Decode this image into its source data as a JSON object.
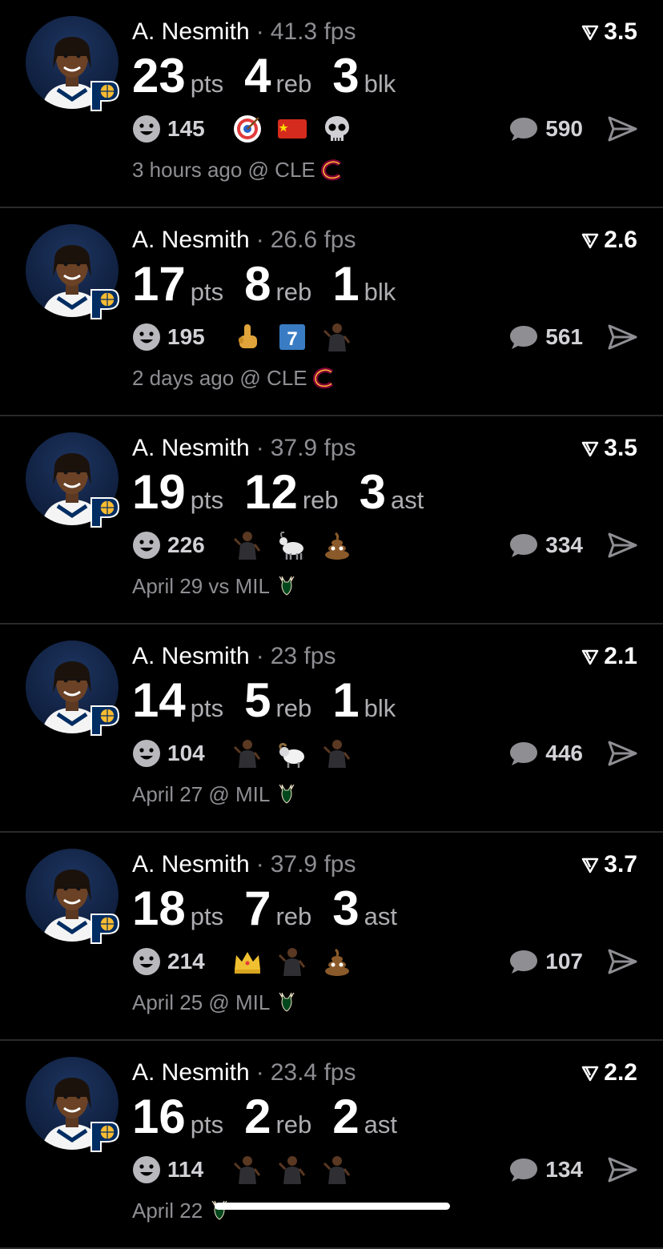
{
  "feed": {
    "posts": [
      {
        "player": "A. Nesmith",
        "fps": "41.3 fps",
        "rating": "3.5",
        "stats": [
          {
            "num": "23",
            "unit": "pts"
          },
          {
            "num": "4",
            "unit": "reb"
          },
          {
            "num": "3",
            "unit": "blk"
          }
        ],
        "reactions": "145",
        "emojis": [
          "target-icon",
          "china-flag-icon",
          "skull-icon"
        ],
        "comments": "590",
        "time": "3 hours ago @ CLE",
        "opponent_logo": "cavaliers-logo"
      },
      {
        "player": "A. Nesmith",
        "fps": "26.6 fps",
        "rating": "2.6",
        "stats": [
          {
            "num": "17",
            "unit": "pts"
          },
          {
            "num": "8",
            "unit": "reb"
          },
          {
            "num": "1",
            "unit": "blk"
          }
        ],
        "reactions": "195",
        "emojis": [
          "middle-finger-icon",
          "jersey-7-icon",
          "player-icon"
        ],
        "comments": "561",
        "time": "2 days ago @ CLE",
        "opponent_logo": "cavaliers-logo"
      },
      {
        "player": "A. Nesmith",
        "fps": "37.9 fps",
        "rating": "3.5",
        "stats": [
          {
            "num": "19",
            "unit": "pts"
          },
          {
            "num": "12",
            "unit": "reb"
          },
          {
            "num": "3",
            "unit": "ast"
          }
        ],
        "reactions": "226",
        "emojis": [
          "player-icon",
          "goat-icon",
          "poop-icon"
        ],
        "comments": "334",
        "time": "April 29 vs MIL",
        "opponent_logo": "bucks-logo"
      },
      {
        "player": "A. Nesmith",
        "fps": "23 fps",
        "rating": "2.1",
        "stats": [
          {
            "num": "14",
            "unit": "pts"
          },
          {
            "num": "5",
            "unit": "reb"
          },
          {
            "num": "1",
            "unit": "blk"
          }
        ],
        "reactions": "104",
        "emojis": [
          "player-icon",
          "ram-icon",
          "player-icon"
        ],
        "comments": "446",
        "time": "April 27 @ MIL",
        "opponent_logo": "bucks-logo"
      },
      {
        "player": "A. Nesmith",
        "fps": "37.9 fps",
        "rating": "3.7",
        "stats": [
          {
            "num": "18",
            "unit": "pts"
          },
          {
            "num": "7",
            "unit": "reb"
          },
          {
            "num": "3",
            "unit": "ast"
          }
        ],
        "reactions": "214",
        "emojis": [
          "crown-icon",
          "player-icon",
          "poop-icon"
        ],
        "comments": "107",
        "time": "April 25 @ MIL",
        "opponent_logo": "bucks-logo"
      },
      {
        "player": "A. Nesmith",
        "fps": "23.4 fps",
        "rating": "2.2",
        "stats": [
          {
            "num": "16",
            "unit": "pts"
          },
          {
            "num": "2",
            "unit": "reb"
          },
          {
            "num": "2",
            "unit": "ast"
          }
        ],
        "reactions": "114",
        "emojis": [
          "player-icon",
          "player-icon",
          "player-icon"
        ],
        "comments": "134",
        "time": "April 22",
        "opponent_logo": "bucks-logo"
      }
    ]
  },
  "colors": {
    "background": "#000000",
    "divider": "#2a2a2c",
    "muted_text": "#8e8e93",
    "pacers_navy": "#002D62",
    "pacers_gold": "#FDBB30",
    "cavs_wine": "#860038",
    "bucks_green": "#00471B"
  }
}
